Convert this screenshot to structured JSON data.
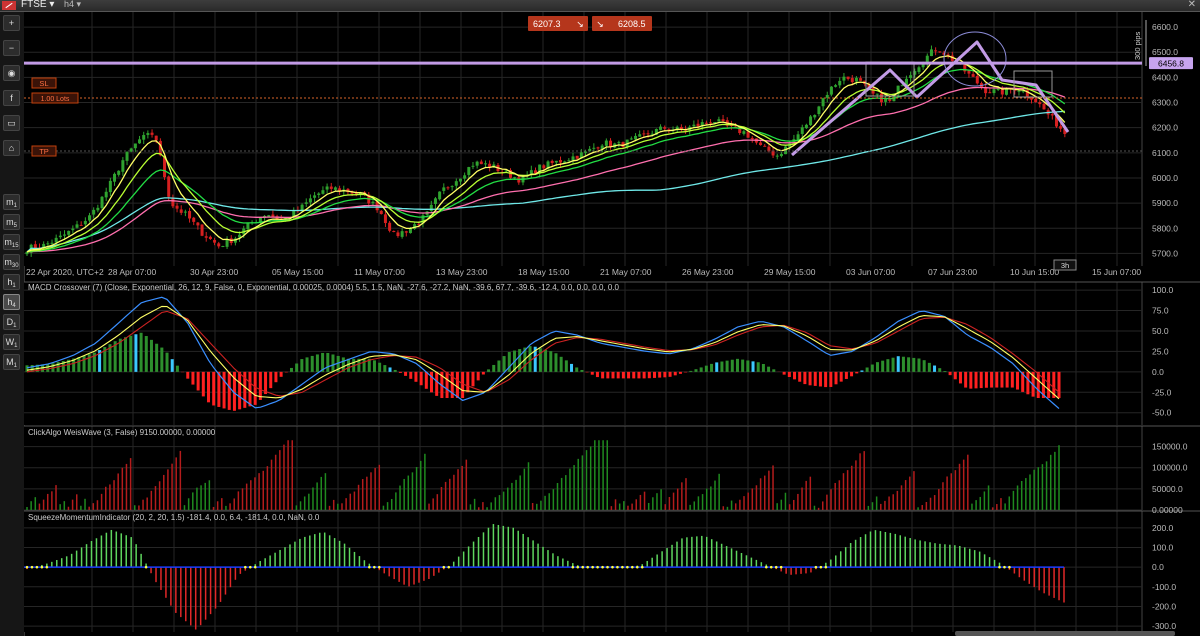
{
  "header": {
    "symbol": "FTSE",
    "timeframe": "h4",
    "close_symbol": "✕"
  },
  "toolbar": {
    "tools": [
      {
        "name": "zoom-in-icon",
        "glyph": "+"
      },
      {
        "name": "zoom-out-icon",
        "glyph": "−"
      },
      {
        "name": "indicator-icon",
        "glyph": "◉"
      },
      {
        "name": "facebook-icon",
        "glyph": "f"
      },
      {
        "name": "screenshot-icon",
        "glyph": "▭"
      },
      {
        "name": "template-icon",
        "glyph": "⌂"
      }
    ],
    "timeframes": [
      {
        "label": "m",
        "sub": "1"
      },
      {
        "label": "m",
        "sub": "5"
      },
      {
        "label": "m",
        "sub": "15"
      },
      {
        "label": "m",
        "sub": "30"
      },
      {
        "label": "h",
        "sub": "1"
      },
      {
        "label": "h",
        "sub": "4"
      },
      {
        "label": "D",
        "sub": "1"
      },
      {
        "label": "W",
        "sub": "1"
      },
      {
        "label": "M",
        "sub": "1"
      }
    ],
    "active_timeframe_index": 5
  },
  "trade": {
    "sell_price": "6207.3",
    "sell_arrow": "↘",
    "buy_price": "6208.5",
    "buy_arrow": "↘",
    "sl_label": "SL",
    "lots_label": "1.00 Lots",
    "tp_label": "TP",
    "horizontal_line_label": "6456.8",
    "pips_label": "300 pips",
    "period_badge": "3h"
  },
  "colors": {
    "background": "#000000",
    "grid": "#262626",
    "bull": "#2fa32f",
    "bear": "#d62020",
    "ema_fast": "#ffff66",
    "ema_mid": "#b8ff33",
    "ema_slow": "#22dd44",
    "ema_pink": "#ff6fae",
    "sma_cyan": "#6fe8e8",
    "hline": "#c29be6",
    "macd": "#3a8fff",
    "signal_red": "#cc2222",
    "signal_yellow": "#ffff66",
    "hist_pos": "#2d8f2d",
    "hist_light": "#3cc8ff",
    "hist_neg": "#ff2020",
    "weis_up": "#1f8a1f",
    "weis_down": "#b41c1c",
    "sqz_up": "#5ed65e",
    "sqz_down": "#e02828",
    "sqz_zero": "#1b3cff",
    "sqz_dot": "#ffff44"
  },
  "chart_data": [
    {
      "type": "candlestick",
      "title": "FTSE",
      "timeframe": "h4",
      "x_tick_labels": [
        "22 Apr 2020, UTC+2",
        "28 Apr 07:00",
        "30 Apr 23:00",
        "05 May 15:00",
        "11 May 07:00",
        "13 May 23:00",
        "18 May 15:00",
        "21 May 07:00",
        "26 May 23:00",
        "29 May 15:00",
        "03 Jun 07:00",
        "07 Jun 23:00",
        "10 Jun 15:00",
        "15 Jun 07:00"
      ],
      "y_ticks": [
        "6600.0",
        "6500.0",
        "6400.0",
        "6300.0",
        "6200.0",
        "6100.0",
        "6000.0",
        "5900.0",
        "5800.0",
        "5700.0"
      ],
      "ylim": [
        5650,
        6660
      ],
      "close_path": [
        5720,
        5730,
        5760,
        5800,
        5850,
        5950,
        6070,
        6150,
        6180,
        5900,
        5850,
        5780,
        5730,
        5760,
        5820,
        5860,
        5830,
        5870,
        5930,
        5960,
        5950,
        5930,
        5880,
        5770,
        5800,
        5850,
        5950,
        6000,
        6060,
        6050,
        6020,
        5990,
        6040,
        6060,
        6080,
        6100,
        6140,
        6130,
        6150,
        6180,
        6200,
        6190,
        6210,
        6230,
        6200,
        6180,
        6120,
        6090,
        6150,
        6230,
        6330,
        6400,
        6390,
        6330,
        6300,
        6400,
        6460,
        6520,
        6470,
        6410,
        6350,
        6340,
        6360,
        6320,
        6250,
        6180
      ],
      "horizontal_line": 6456.8,
      "overlays": [
        {
          "name": "ema_fast",
          "color": "#ffff66"
        },
        {
          "name": "ema_mid",
          "color": "#b8ff33"
        },
        {
          "name": "ema_slow",
          "color": "#22dd44"
        },
        {
          "name": "ema_pink",
          "color": "#ff6fae"
        },
        {
          "name": "sma_cyan",
          "color": "#6fe8e8"
        }
      ]
    },
    {
      "type": "line",
      "title": "MACD Crossover (7) (Close, Exponential, 26, 12, 9, False, 0, Exponential, 0.00025, 0.0004) 5.5, 1.5, NaN, -27.6, -27.2, NaN, -39.6, 67.7, -39.6, -12.4, 0.0, 0.0, 0.0, 0.0",
      "y_ticks": [
        "100.0",
        "75.0",
        "50.0",
        "25.0",
        "0.0",
        "-25.0",
        "-50.0"
      ],
      "ylim": [
        -65,
        105
      ],
      "macd_path": [
        5,
        10,
        20,
        35,
        60,
        85,
        92,
        60,
        10,
        -25,
        -45,
        -35,
        -15,
        5,
        15,
        25,
        22,
        10,
        -15,
        -35,
        -25,
        5,
        35,
        50,
        45,
        35,
        30,
        25,
        22,
        28,
        40,
        55,
        62,
        55,
        38,
        20,
        25,
        42,
        62,
        75,
        68,
        45,
        30,
        10,
        -20,
        -45
      ],
      "signal_path": [
        0,
        4,
        10,
        20,
        35,
        55,
        75,
        65,
        35,
        5,
        -20,
        -30,
        -25,
        -10,
        5,
        15,
        20,
        18,
        5,
        -15,
        -25,
        -10,
        15,
        35,
        42,
        40,
        35,
        30,
        26,
        27,
        33,
        45,
        55,
        57,
        48,
        32,
        28,
        35,
        50,
        65,
        67,
        58,
        42,
        22,
        0,
        -25
      ]
    },
    {
      "type": "bar",
      "title": "ClickAlgo WeisWave (3, False) 9150.00000, 0.00000",
      "y_ticks": [
        "150000.0",
        "100000.0",
        "50000.0",
        "0.00000"
      ],
      "ylim": [
        0,
        175000
      ]
    },
    {
      "type": "bar",
      "title": "SqueezeMomentumIndicator (20, 2, 20, 1.5) -181.4, 0.0, 6.4, -181.4, 0.0, NaN, 0.0",
      "y_ticks": [
        "200.0",
        "100.0",
        "0.0",
        "-100.0",
        "-200.0",
        "-300.0"
      ],
      "ylim": [
        -330,
        250
      ],
      "momentum_path": [
        -10,
        20,
        60,
        130,
        190,
        150,
        -60,
        -230,
        -320,
        -200,
        -40,
        30,
        90,
        150,
        180,
        120,
        30,
        -40,
        -100,
        -60,
        10,
        120,
        220,
        200,
        130,
        60,
        10,
        -5,
        -5,
        10,
        80,
        150,
        160,
        110,
        60,
        10,
        -40,
        -30,
        40,
        130,
        190,
        170,
        140,
        120,
        110,
        80,
        20,
        -60,
        -130,
        -180
      ]
    }
  ]
}
